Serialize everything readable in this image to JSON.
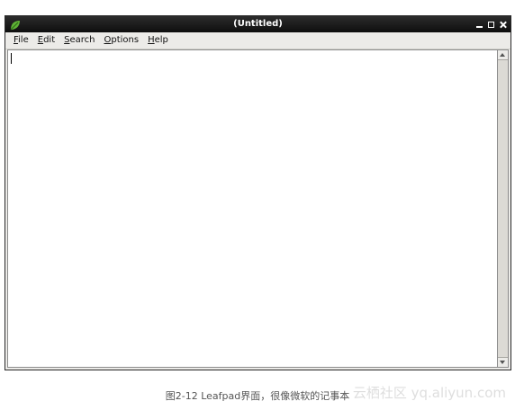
{
  "window": {
    "title": "(Untitled)",
    "icon": "leaf-icon"
  },
  "menubar": {
    "items": [
      {
        "mnemonic": "F",
        "rest": "ile"
      },
      {
        "mnemonic": "E",
        "rest": "dit"
      },
      {
        "mnemonic": "S",
        "rest": "earch"
      },
      {
        "mnemonic": "O",
        "rest": "ptions"
      },
      {
        "mnemonic": "H",
        "rest": "elp"
      }
    ]
  },
  "editor": {
    "content": ""
  },
  "caption": "图2-12 Leafpad界面，很像微软的记事本",
  "watermark": "云栖社区 yq.aliyun.com"
}
